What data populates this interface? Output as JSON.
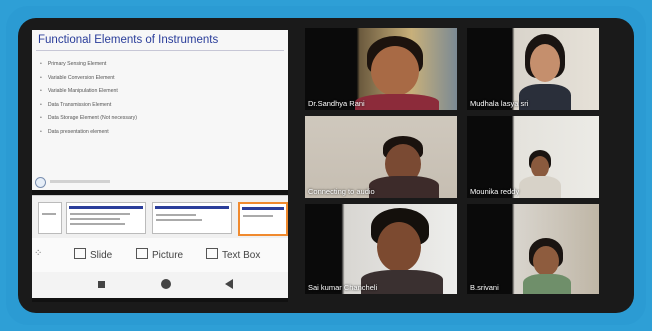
{
  "slide": {
    "title": "Functional Elements of Instruments",
    "bullets": [
      "Primary Sensing Element",
      "Variable Conversion Element",
      "Variable Manipulation Element",
      "Data Transmission Element",
      "Data Storage Element (Not necessary)",
      "Data presentation element"
    ]
  },
  "toolbar": {
    "slide_label": "Slide",
    "picture_label": "Picture",
    "textbox_label": "Text Box"
  },
  "participants": [
    {
      "name": "Dr.Sandhya Rani"
    },
    {
      "name": "Mudhala lasya sri"
    },
    {
      "name": "Connecting to audio"
    },
    {
      "name": "Mounika reddy"
    },
    {
      "name": "Sai kumar Chancheli"
    },
    {
      "name": "B.srivani"
    }
  ],
  "colors": {
    "frame": "#2e9fd6",
    "panel": "#1a1a1a",
    "slide_title": "#2a3d9a"
  }
}
